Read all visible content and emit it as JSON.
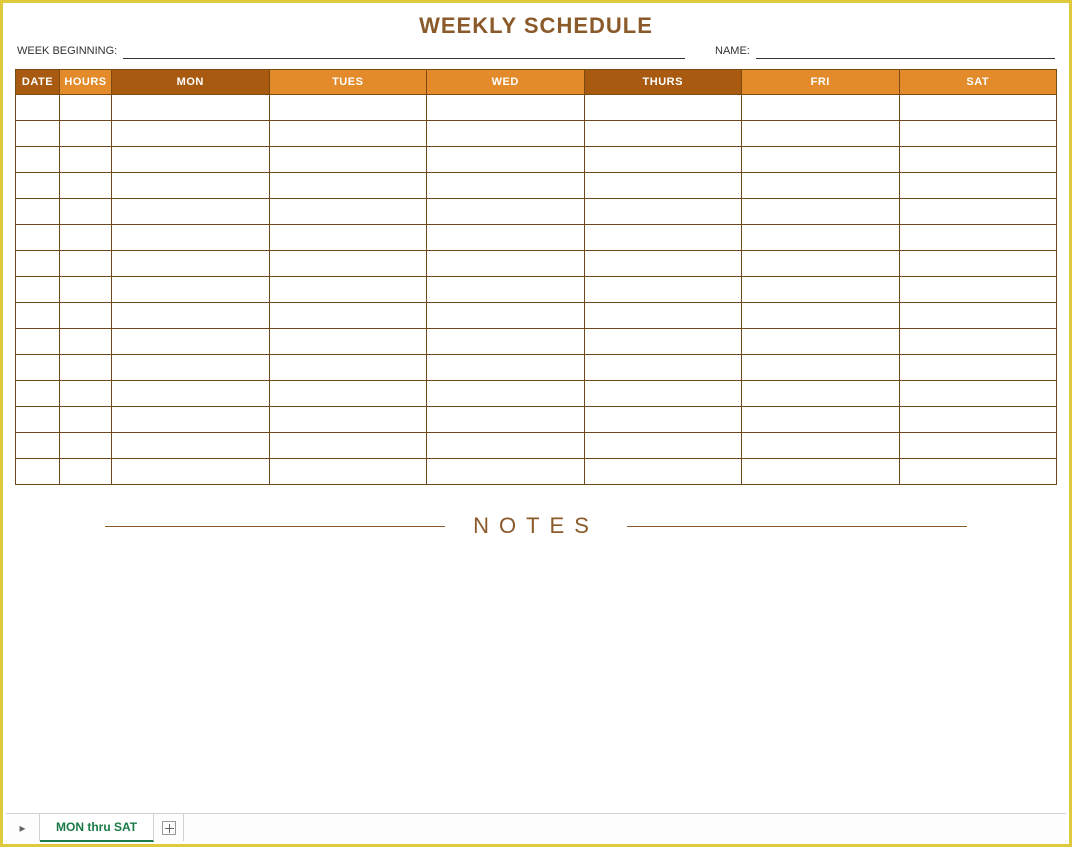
{
  "title": "WEEKLY SCHEDULE",
  "meta": {
    "week_beginning_label": "WEEK BEGINNING:",
    "week_beginning_value": "",
    "name_label": "NAME:",
    "name_value": ""
  },
  "columns": [
    {
      "label": "DATE",
      "style": "dark",
      "cls": "col-date"
    },
    {
      "label": "HOURS",
      "style": "light",
      "cls": "col-hours"
    },
    {
      "label": "MON",
      "style": "dark",
      "cls": "col-day"
    },
    {
      "label": "TUES",
      "style": "light",
      "cls": "col-day"
    },
    {
      "label": "WED",
      "style": "light",
      "cls": "col-day"
    },
    {
      "label": "THURS",
      "style": "dark",
      "cls": "col-day"
    },
    {
      "label": "FRI",
      "style": "light",
      "cls": "col-day"
    },
    {
      "label": "SAT",
      "style": "light",
      "cls": "col-day"
    }
  ],
  "row_count": 15,
  "notes_label": "NOTES",
  "sheet_tab": "MON thru SAT"
}
